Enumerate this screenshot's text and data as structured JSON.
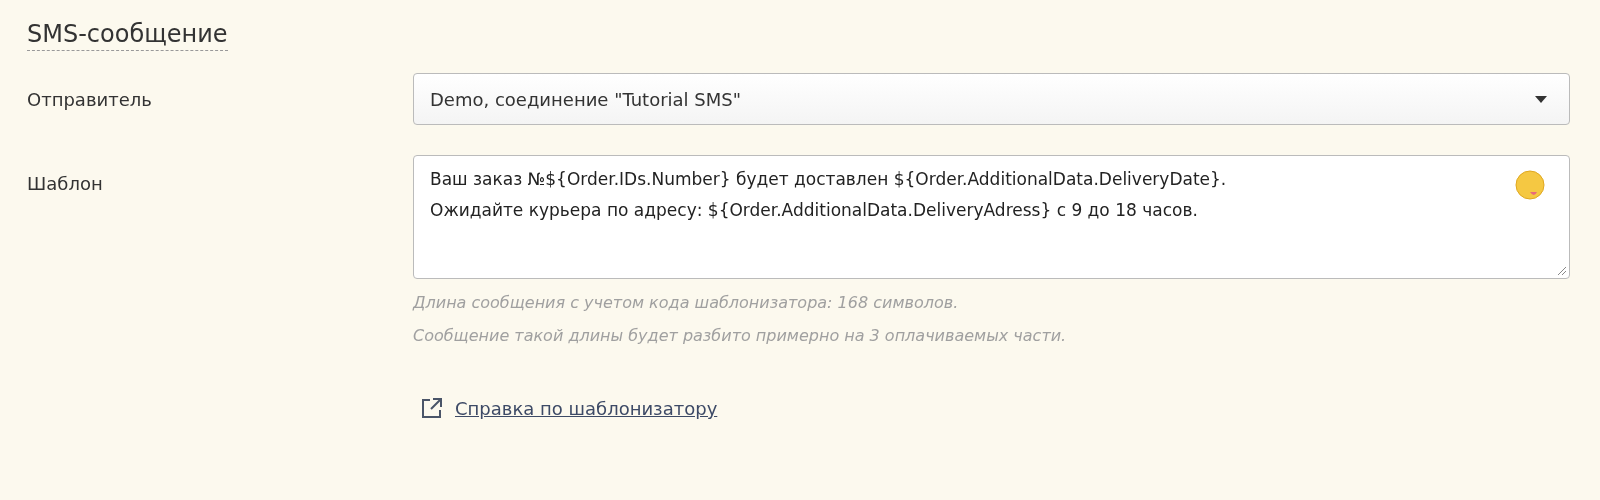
{
  "section": {
    "title": "SMS-сообщение"
  },
  "sender": {
    "label": "Отправитель",
    "value": "Demo, соединение \"Tutorial SMS\""
  },
  "template": {
    "label": "Шаблон",
    "value": "Ваш заказ №${Order.IDs.Number} будет доставлен ${Order.AdditionalData.DeliveryDate}.\nОжидайте курьера по адресу: ${Order.AdditionalData.DeliveryAdress} с 9 до 18 часов."
  },
  "hints": [
    "Длина сообщения с учетом кода шаблонизатора: 168 символов.",
    "Сообщение такой длины будет разбито примерно на 3 оплачиваемых части."
  ],
  "help_link": "Справка по шаблонизатору"
}
